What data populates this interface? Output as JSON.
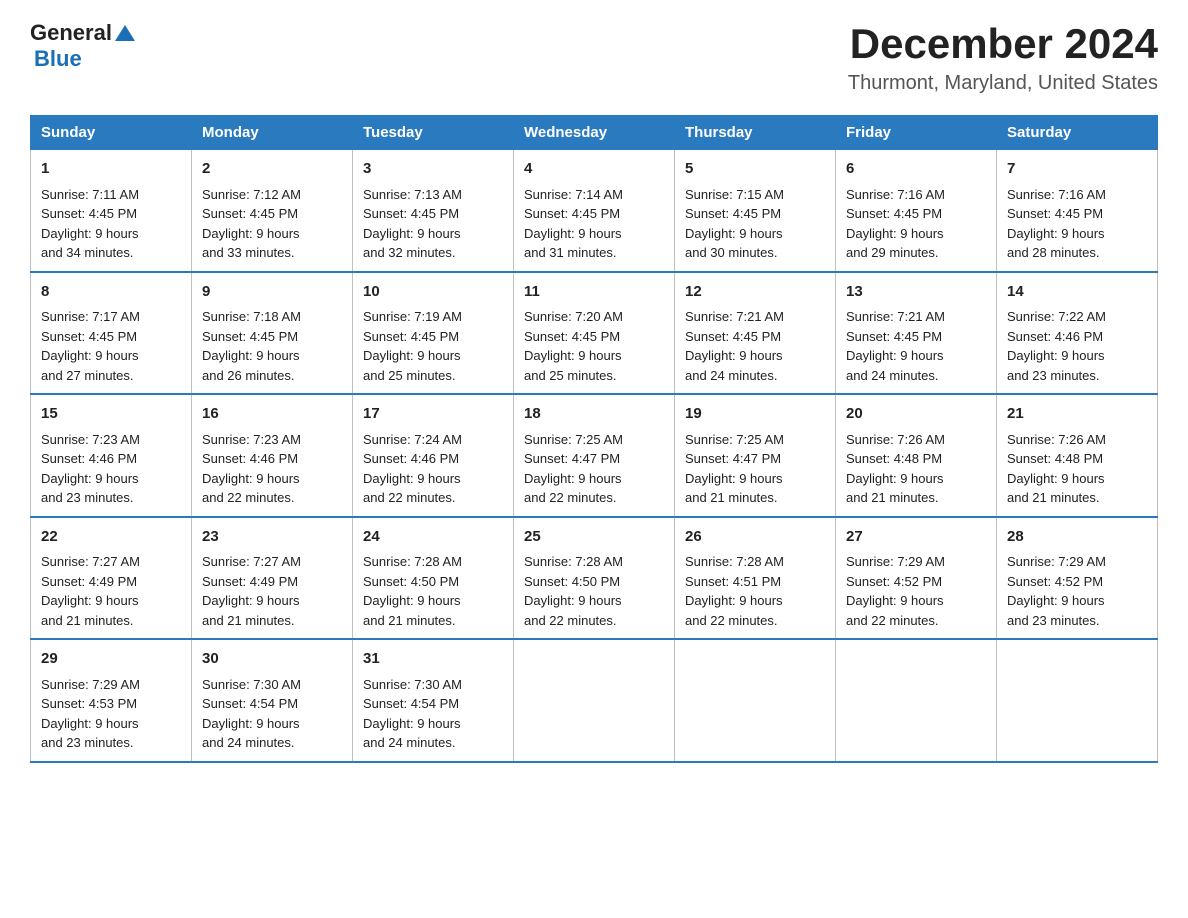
{
  "header": {
    "logo_general": "General",
    "logo_blue": "Blue",
    "month": "December 2024",
    "location": "Thurmont, Maryland, United States"
  },
  "days_of_week": [
    "Sunday",
    "Monday",
    "Tuesday",
    "Wednesday",
    "Thursday",
    "Friday",
    "Saturday"
  ],
  "weeks": [
    [
      {
        "day": "1",
        "sunrise": "7:11 AM",
        "sunset": "4:45 PM",
        "daylight": "9 hours and 34 minutes."
      },
      {
        "day": "2",
        "sunrise": "7:12 AM",
        "sunset": "4:45 PM",
        "daylight": "9 hours and 33 minutes."
      },
      {
        "day": "3",
        "sunrise": "7:13 AM",
        "sunset": "4:45 PM",
        "daylight": "9 hours and 32 minutes."
      },
      {
        "day": "4",
        "sunrise": "7:14 AM",
        "sunset": "4:45 PM",
        "daylight": "9 hours and 31 minutes."
      },
      {
        "day": "5",
        "sunrise": "7:15 AM",
        "sunset": "4:45 PM",
        "daylight": "9 hours and 30 minutes."
      },
      {
        "day": "6",
        "sunrise": "7:16 AM",
        "sunset": "4:45 PM",
        "daylight": "9 hours and 29 minutes."
      },
      {
        "day": "7",
        "sunrise": "7:16 AM",
        "sunset": "4:45 PM",
        "daylight": "9 hours and 28 minutes."
      }
    ],
    [
      {
        "day": "8",
        "sunrise": "7:17 AM",
        "sunset": "4:45 PM",
        "daylight": "9 hours and 27 minutes."
      },
      {
        "day": "9",
        "sunrise": "7:18 AM",
        "sunset": "4:45 PM",
        "daylight": "9 hours and 26 minutes."
      },
      {
        "day": "10",
        "sunrise": "7:19 AM",
        "sunset": "4:45 PM",
        "daylight": "9 hours and 25 minutes."
      },
      {
        "day": "11",
        "sunrise": "7:20 AM",
        "sunset": "4:45 PM",
        "daylight": "9 hours and 25 minutes."
      },
      {
        "day": "12",
        "sunrise": "7:21 AM",
        "sunset": "4:45 PM",
        "daylight": "9 hours and 24 minutes."
      },
      {
        "day": "13",
        "sunrise": "7:21 AM",
        "sunset": "4:45 PM",
        "daylight": "9 hours and 24 minutes."
      },
      {
        "day": "14",
        "sunrise": "7:22 AM",
        "sunset": "4:46 PM",
        "daylight": "9 hours and 23 minutes."
      }
    ],
    [
      {
        "day": "15",
        "sunrise": "7:23 AM",
        "sunset": "4:46 PM",
        "daylight": "9 hours and 23 minutes."
      },
      {
        "day": "16",
        "sunrise": "7:23 AM",
        "sunset": "4:46 PM",
        "daylight": "9 hours and 22 minutes."
      },
      {
        "day": "17",
        "sunrise": "7:24 AM",
        "sunset": "4:46 PM",
        "daylight": "9 hours and 22 minutes."
      },
      {
        "day": "18",
        "sunrise": "7:25 AM",
        "sunset": "4:47 PM",
        "daylight": "9 hours and 22 minutes."
      },
      {
        "day": "19",
        "sunrise": "7:25 AM",
        "sunset": "4:47 PM",
        "daylight": "9 hours and 21 minutes."
      },
      {
        "day": "20",
        "sunrise": "7:26 AM",
        "sunset": "4:48 PM",
        "daylight": "9 hours and 21 minutes."
      },
      {
        "day": "21",
        "sunrise": "7:26 AM",
        "sunset": "4:48 PM",
        "daylight": "9 hours and 21 minutes."
      }
    ],
    [
      {
        "day": "22",
        "sunrise": "7:27 AM",
        "sunset": "4:49 PM",
        "daylight": "9 hours and 21 minutes."
      },
      {
        "day": "23",
        "sunrise": "7:27 AM",
        "sunset": "4:49 PM",
        "daylight": "9 hours and 21 minutes."
      },
      {
        "day": "24",
        "sunrise": "7:28 AM",
        "sunset": "4:50 PM",
        "daylight": "9 hours and 21 minutes."
      },
      {
        "day": "25",
        "sunrise": "7:28 AM",
        "sunset": "4:50 PM",
        "daylight": "9 hours and 22 minutes."
      },
      {
        "day": "26",
        "sunrise": "7:28 AM",
        "sunset": "4:51 PM",
        "daylight": "9 hours and 22 minutes."
      },
      {
        "day": "27",
        "sunrise": "7:29 AM",
        "sunset": "4:52 PM",
        "daylight": "9 hours and 22 minutes."
      },
      {
        "day": "28",
        "sunrise": "7:29 AM",
        "sunset": "4:52 PM",
        "daylight": "9 hours and 23 minutes."
      }
    ],
    [
      {
        "day": "29",
        "sunrise": "7:29 AM",
        "sunset": "4:53 PM",
        "daylight": "9 hours and 23 minutes."
      },
      {
        "day": "30",
        "sunrise": "7:30 AM",
        "sunset": "4:54 PM",
        "daylight": "9 hours and 24 minutes."
      },
      {
        "day": "31",
        "sunrise": "7:30 AM",
        "sunset": "4:54 PM",
        "daylight": "9 hours and 24 minutes."
      },
      null,
      null,
      null,
      null
    ]
  ],
  "labels": {
    "sunrise": "Sunrise:",
    "sunset": "Sunset:",
    "daylight": "Daylight:"
  }
}
